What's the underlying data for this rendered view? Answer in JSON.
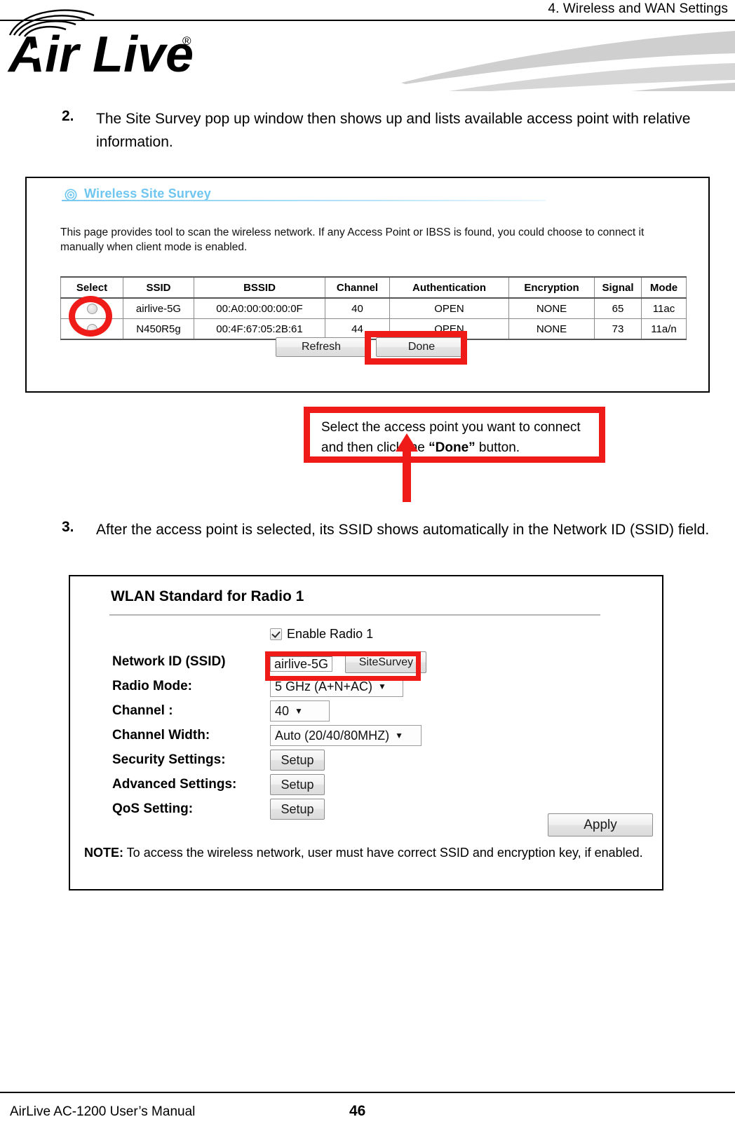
{
  "header": {
    "running_title": "4. Wireless and WAN Settings",
    "logo_text": "Air Live",
    "logo_mark": "registered-trademark"
  },
  "steps": [
    {
      "number": "2.",
      "text": "The Site Survey pop up window then shows up and lists available access point with relative information."
    },
    {
      "number": "3.",
      "text": "After the access point is selected, its SSID shows automatically in the Network ID (SSID) field."
    }
  ],
  "site_survey": {
    "panel_title": "Wireless Site Survey",
    "description": "This page provides tool to scan the wireless network. If any Access Point or IBSS is found, you could choose to connect it manually when client mode is enabled.",
    "table": {
      "columns": [
        "Select",
        "SSID",
        "BSSID",
        "Channel",
        "Authentication",
        "Encryption",
        "Signal",
        "Mode"
      ],
      "rows": [
        {
          "selected": true,
          "ssid": "airlive-5G",
          "bssid": "00:A0:00:00:00:0F",
          "channel": "40",
          "authentication": "OPEN",
          "encryption": "NONE",
          "signal": "65",
          "mode": "11ac"
        },
        {
          "selected": false,
          "ssid": "N450R5g",
          "bssid": "00:4F:67:05:2B:61",
          "channel": "44",
          "authentication": "OPEN",
          "encryption": "NONE",
          "signal": "73",
          "mode": "11a/n"
        }
      ]
    },
    "buttons": {
      "refresh": "Refresh",
      "done": "Done"
    }
  },
  "callout": {
    "line1": "Select the access point you want to connect",
    "line2_prefix": "and then click the ",
    "line2_bold": "“Done”",
    "line2_suffix": " button.",
    "border_color": "#ee1b18"
  },
  "wlan": {
    "title": "WLAN Standard for Radio 1",
    "enable_radio_label": "Enable Radio 1",
    "enable_radio_checked": true,
    "fields": {
      "ssid_label": "Network ID (SSID)",
      "ssid_value": "airlive-5G",
      "sitesurvey_button": "SiteSurvey",
      "radio_mode_label": "Radio Mode:",
      "radio_mode_value": "5 GHz (A+N+AC)",
      "channel_label": "Channel :",
      "channel_value": "40",
      "channel_width_label": "Channel Width:",
      "channel_width_value": "Auto (20/40/80MHZ)",
      "security_label": "Security Settings:",
      "security_button": "Setup",
      "advanced_label": "Advanced Settings:",
      "advanced_button": "Setup",
      "qos_label": "QoS Setting:",
      "qos_button": "Setup"
    },
    "apply_button": "Apply",
    "note_prefix": "NOTE:",
    "note_text": " To access the wireless network, user must have correct SSID and encryption key, if enabled."
  },
  "footer": {
    "left": "AirLive AC-1200 User’s Manual",
    "page_number": "46"
  },
  "colors": {
    "accent_blue": "#6ec6f0",
    "highlight_red": "#ee1b18",
    "swoosh_gray": "#cfcfcf"
  }
}
